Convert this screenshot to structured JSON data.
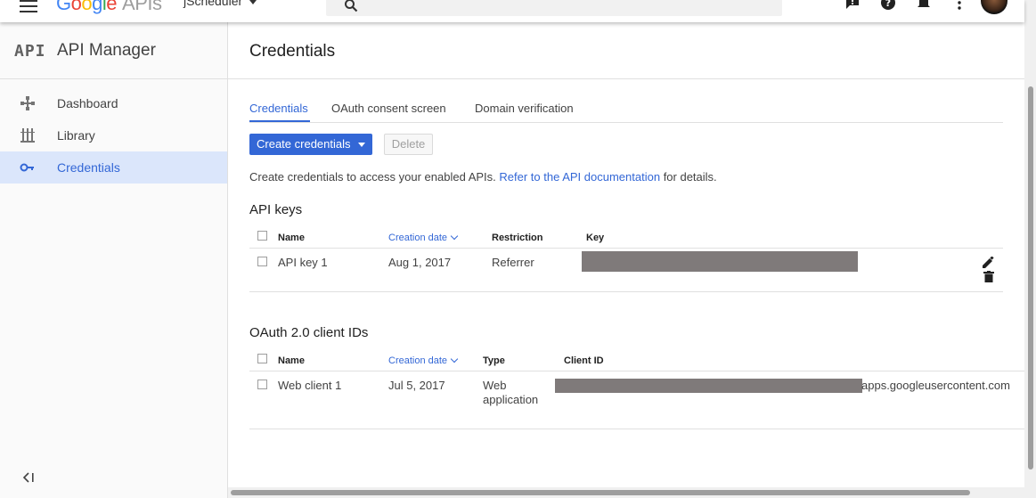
{
  "topbar": {
    "logo": [
      "G",
      "o",
      "o",
      "g",
      "l",
      "e"
    ],
    "logo_suffix": "APIs",
    "project": "jScheduler"
  },
  "sidebar": {
    "logo": "API",
    "title": "API Manager",
    "items": [
      {
        "label": "Dashboard",
        "icon": "dashboard-icon"
      },
      {
        "label": "Library",
        "icon": "library-icon"
      },
      {
        "label": "Credentials",
        "icon": "key-icon",
        "active": true
      }
    ]
  },
  "page": {
    "title": "Credentials",
    "tabs": [
      {
        "label": "Credentials",
        "active": true
      },
      {
        "label": "OAuth consent screen"
      },
      {
        "label": "Domain verification"
      }
    ],
    "create_button": "Create credentials",
    "delete_button": "Delete",
    "info_text": "Create credentials to access your enabled APIs.",
    "info_link": "Refer to the API documentation",
    "info_suffix": "for details."
  },
  "api_keys": {
    "title": "API keys",
    "headers": {
      "name": "Name",
      "date": "Creation date",
      "restriction": "Restriction",
      "key": "Key"
    },
    "rows": [
      {
        "name": "API key 1",
        "date": "Aug 1, 2017",
        "restriction": "Referrer"
      }
    ]
  },
  "oauth": {
    "title": "OAuth 2.0 client IDs",
    "headers": {
      "name": "Name",
      "date": "Creation date",
      "type": "Type",
      "client_id": "Client ID"
    },
    "rows": [
      {
        "name": "Web client 1",
        "date": "Jul 5, 2017",
        "type_line1": "Web",
        "type_line2": "application",
        "client_id_suffix": "apps.googleusercontent.com"
      }
    ]
  },
  "colors": {
    "accent": "#3367d6",
    "redaction": "#7f7a7a"
  }
}
